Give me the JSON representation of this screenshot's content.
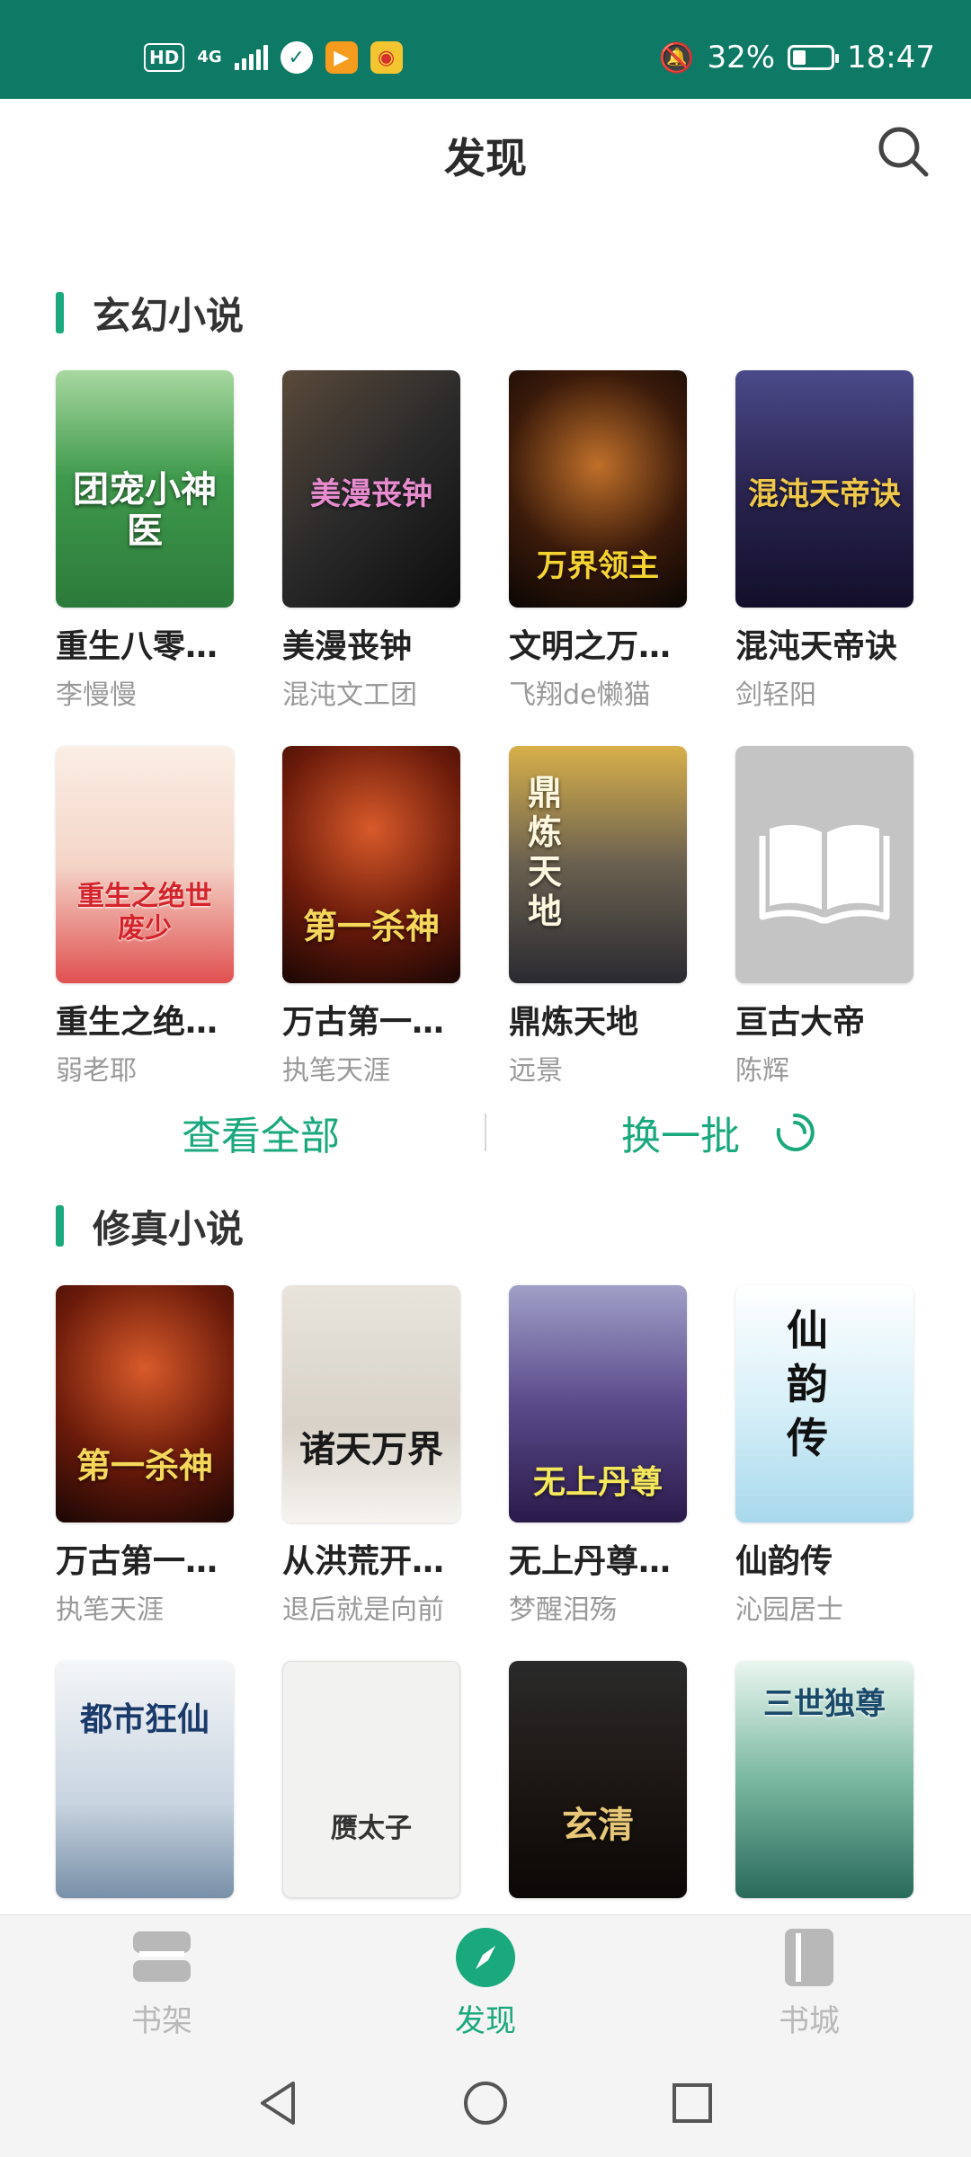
{
  "status_bar": {
    "hd": "HD",
    "network": "4G",
    "battery_percent": "32%",
    "time": "18:47",
    "icons": [
      "signal-icon",
      "app-icon",
      "video-icon",
      "weibo-icon",
      "mute-icon",
      "battery-icon"
    ]
  },
  "header": {
    "title": "发现",
    "search_icon": "search-icon"
  },
  "sections": [
    {
      "title": "玄幻小说",
      "books": [
        {
          "title": "重生八零…",
          "author": "李慢慢",
          "cover_text": "团宠小神医"
        },
        {
          "title": "美漫丧钟",
          "author": "混沌文工团",
          "cover_text": "美漫丧钟"
        },
        {
          "title": "文明之万…",
          "author": "飞翔de懒猫",
          "cover_text": "万界领主"
        },
        {
          "title": "混沌天帝诀",
          "author": "剑轻阳",
          "cover_text": "混沌天帝诀"
        },
        {
          "title": "重生之绝…",
          "author": "弱老耶",
          "cover_text": "重生之绝世废少"
        },
        {
          "title": "万古第一…",
          "author": "执笔天涯",
          "cover_text": "第一杀神"
        },
        {
          "title": "鼎炼天地",
          "author": "远景",
          "cover_text": "鼎炼天地"
        },
        {
          "title": "亘古大帝",
          "author": "陈辉",
          "cover_text": ""
        }
      ]
    },
    {
      "title": "修真小说",
      "books": [
        {
          "title": "万古第一…",
          "author": "执笔天涯",
          "cover_text": "第一杀神"
        },
        {
          "title": "从洪荒开…",
          "author": "退后就是向前",
          "cover_text": "诸天万界"
        },
        {
          "title": "无上丹尊…",
          "author": "梦醒泪殇",
          "cover_text": "无上丹尊"
        },
        {
          "title": "仙韵传",
          "author": "沁园居士",
          "cover_text": "仙韵传"
        },
        {
          "title": "",
          "author": "",
          "cover_text": "都市狂仙"
        },
        {
          "title": "",
          "author": "",
          "cover_text": "赝太子"
        },
        {
          "title": "",
          "author": "",
          "cover_text": "玄清"
        },
        {
          "title": "",
          "author": "",
          "cover_text": "三世独尊"
        }
      ]
    }
  ],
  "actions": {
    "view_all": "查看全部",
    "refresh": "换一批"
  },
  "bottom_nav": [
    {
      "label": "书架",
      "icon": "bookshelf-icon",
      "active": false
    },
    {
      "label": "发现",
      "icon": "compass-icon",
      "active": true
    },
    {
      "label": "书城",
      "icon": "bookstore-icon",
      "active": false
    }
  ],
  "colors": {
    "accent": "#1aa87d",
    "status_bar": "#0e7a66",
    "inactive": "#b8b8b8"
  }
}
